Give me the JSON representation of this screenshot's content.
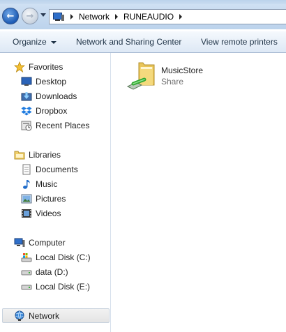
{
  "address_bar": {
    "path": [
      "Network",
      "RUNEAUDIO"
    ]
  },
  "command_bar": {
    "organize": "Organize",
    "sharing_center": "Network and Sharing Center",
    "remote_printers": "View remote printers"
  },
  "nav_pane": {
    "favorites": {
      "label": "Favorites",
      "items": [
        {
          "label": "Desktop",
          "icon": "desktop-icon"
        },
        {
          "label": "Downloads",
          "icon": "downloads-icon"
        },
        {
          "label": "Dropbox",
          "icon": "dropbox-icon"
        },
        {
          "label": "Recent Places",
          "icon": "recent-places-icon"
        }
      ]
    },
    "libraries": {
      "label": "Libraries",
      "items": [
        {
          "label": "Documents",
          "icon": "documents-icon"
        },
        {
          "label": "Music",
          "icon": "music-icon"
        },
        {
          "label": "Pictures",
          "icon": "pictures-icon"
        },
        {
          "label": "Videos",
          "icon": "videos-icon"
        }
      ]
    },
    "computer": {
      "label": "Computer",
      "items": [
        {
          "label": "Local Disk (C:)",
          "icon": "system-drive-icon"
        },
        {
          "label": "data (D:)",
          "icon": "drive-icon"
        },
        {
          "label": "Local Disk (E:)",
          "icon": "drive-icon"
        }
      ]
    },
    "network": {
      "label": "Network",
      "selected": true
    }
  },
  "content": {
    "items": [
      {
        "name": "MusicStore",
        "type": "Share",
        "icon": "network-share-folder-icon"
      }
    ]
  },
  "colors": {
    "accent": "#1d5cb5",
    "folder": "#f2d36b",
    "share_cable": "#2fa82f"
  }
}
